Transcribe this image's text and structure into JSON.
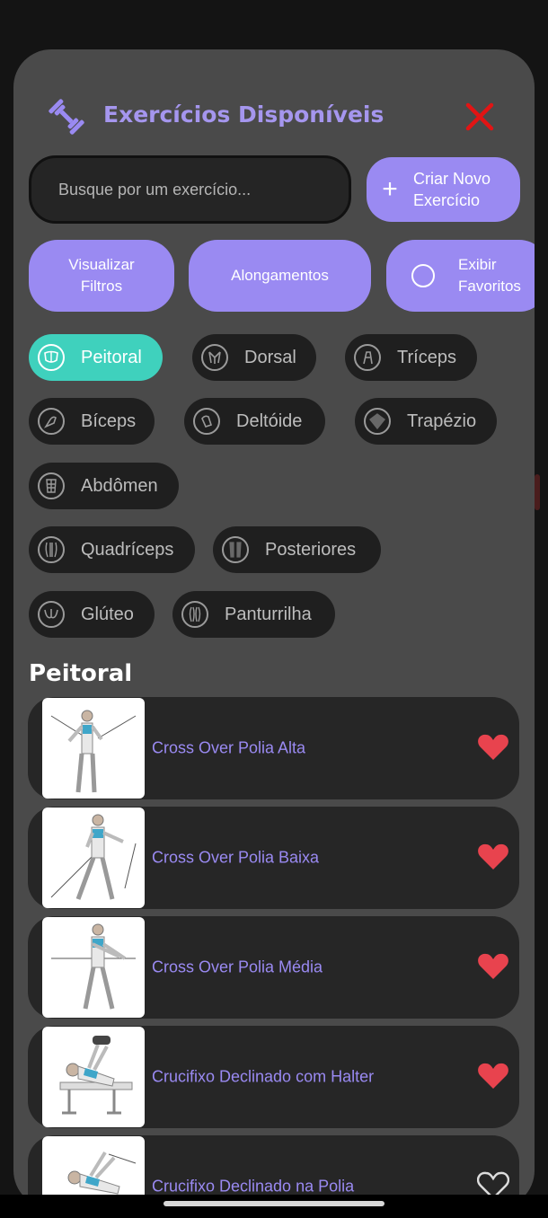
{
  "header": {
    "title": "Exercícios Disponíveis",
    "icon": "dumbbell-icon",
    "close_icon": "close-icon",
    "close_color": "#e21414"
  },
  "search": {
    "placeholder": "Busque por um exercício..."
  },
  "create_button": {
    "label_line1": "Criar Novo",
    "label_line2": "Exercício"
  },
  "actions": {
    "filters_line1": "Visualizar",
    "filters_line2": "Filtros",
    "stretching": "Alongamentos",
    "favorites_line1": "Exibir",
    "favorites_line2": "Favoritos"
  },
  "muscles": [
    {
      "label": "Peitoral",
      "active": true
    },
    {
      "label": "Dorsal",
      "active": false
    },
    {
      "label": "Tríceps",
      "active": false
    },
    {
      "label": "Bíceps",
      "active": false
    },
    {
      "label": "Deltóide",
      "active": false
    },
    {
      "label": "Trapézio",
      "active": false
    },
    {
      "label": "Abdômen",
      "active": false
    },
    {
      "label": "Quadríceps",
      "active": false
    },
    {
      "label": "Posteriores",
      "active": false
    },
    {
      "label": "Glúteo",
      "active": false
    },
    {
      "label": "Panturrilha",
      "active": false
    }
  ],
  "section": {
    "title": "Peitoral"
  },
  "exercises": [
    {
      "name": "Cross Over Polia Alta",
      "favorite": true
    },
    {
      "name": "Cross Over Polia Baixa",
      "favorite": true
    },
    {
      "name": "Cross Over Polia Média",
      "favorite": true
    },
    {
      "name": "Crucifixo Declinado com Halter",
      "favorite": true
    },
    {
      "name": "Crucifixo Declinado na Polia",
      "favorite": false
    }
  ],
  "colors": {
    "accent": "#9a8af2",
    "active_chip": "#3fd1bd",
    "heart": "#e8434e",
    "panel": "#4a4a4a"
  }
}
